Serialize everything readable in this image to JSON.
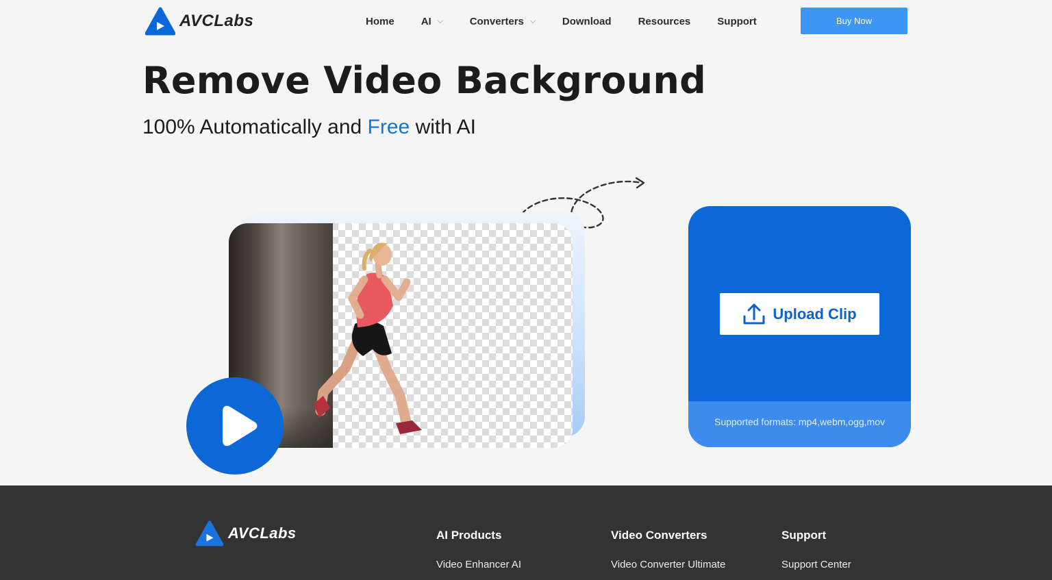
{
  "brand": {
    "name": "AVCLabs",
    "logo_icon": "avclabs-triangle-play-logo",
    "colors": {
      "primary": "#0b68d6",
      "button": "#3d95f5",
      "accent_text": "#1273dc",
      "footer_bg": "#333333"
    }
  },
  "nav": {
    "items": [
      {
        "label": "Home",
        "has_dropdown": false
      },
      {
        "label": "AI",
        "has_dropdown": true
      },
      {
        "label": "Converters",
        "has_dropdown": true
      },
      {
        "label": "Download",
        "has_dropdown": false
      },
      {
        "label": "Resources",
        "has_dropdown": false
      },
      {
        "label": "Support",
        "has_dropdown": false
      }
    ],
    "cta_label": "Buy Now"
  },
  "hero": {
    "title": "Remove Video Background",
    "subtitle_prefix": "100% Automatically and ",
    "subtitle_accent": "Free",
    "subtitle_suffix": " with AI"
  },
  "preview": {
    "play_icon": "play-icon",
    "arrow_icon": "dashed-arrow-icon",
    "background_pattern": "transparency-checkerboard"
  },
  "upload": {
    "button_label": "Upload Clip",
    "button_icon": "upload-icon",
    "formats_text": "Supported formats: mp4,webm,ogg,mov"
  },
  "footer": {
    "columns": [
      {
        "heading": "AI Products",
        "links": [
          "Video Enhancer AI"
        ]
      },
      {
        "heading": "Video Converters",
        "links": [
          "Video Converter Ultimate"
        ]
      },
      {
        "heading": "Support",
        "links": [
          "Support Center"
        ]
      }
    ]
  }
}
